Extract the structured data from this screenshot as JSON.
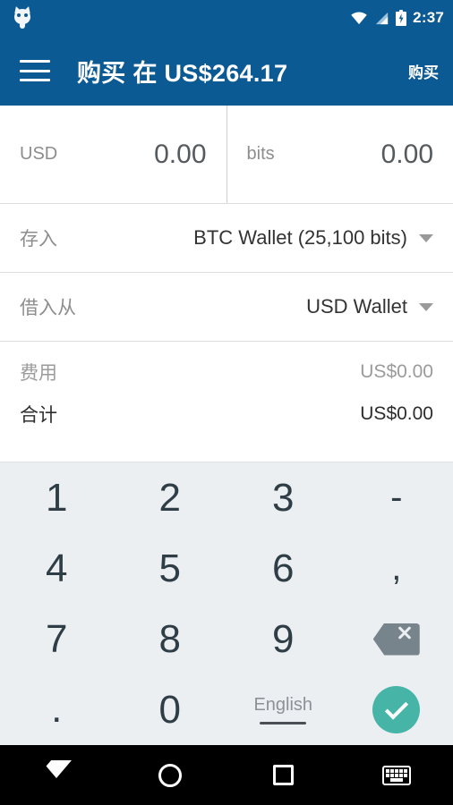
{
  "statusbar": {
    "app_icon": "owl-icon",
    "wifi_icon": "wifi-icon",
    "signal_icon": "cellular-signal-icon",
    "battery_icon": "battery-charging-icon",
    "time": "2:37"
  },
  "appbar": {
    "menu_icon": "hamburger-menu-icon",
    "title": "购买 在 US$264.17",
    "action_label": "购买",
    "background": "#0b5a94"
  },
  "amounts": {
    "fiat": {
      "label": "USD",
      "value": "0.00"
    },
    "crypto": {
      "label": "bits",
      "value": "0.00"
    }
  },
  "selectors": [
    {
      "label": "存入",
      "value": "BTC Wallet (25,100 bits)",
      "caret": "chevron-down-icon"
    },
    {
      "label": "借入从",
      "value": "USD Wallet",
      "caret": "chevron-down-icon"
    }
  ],
  "summary": [
    {
      "label": "费用",
      "value": "US$0.00"
    },
    {
      "label": "合计",
      "value": "US$0.00"
    }
  ],
  "keypad": {
    "background": "#eceff1",
    "keys": [
      "1",
      "2",
      "3",
      "-",
      "4",
      "5",
      "6",
      ",",
      "7",
      "8",
      "9",
      "",
      ".",
      "0",
      "",
      ""
    ],
    "backspace_icon": "backspace-icon",
    "language_label": "English",
    "confirm_icon": "check-icon",
    "confirm_color": "#46b5a7"
  },
  "navbar": {
    "back_icon": "back-triangle-icon",
    "home_icon": "home-circle-icon",
    "recents_icon": "recents-square-icon",
    "keyboard_icon": "keyboard-icon"
  }
}
